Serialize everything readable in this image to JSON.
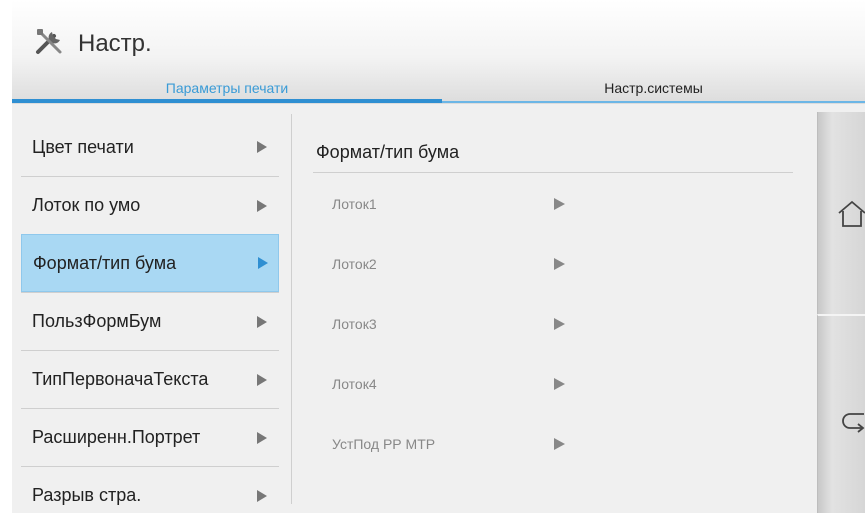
{
  "header": {
    "title": "Настр.",
    "icon": "tools-icon",
    "tabs": [
      {
        "label": "Параметры печати",
        "active": true
      },
      {
        "label": "Настр.системы",
        "active": false
      }
    ],
    "accent": "#2f8fd2"
  },
  "sidebar": {
    "items": [
      {
        "label": "Цвет печати",
        "selected": false
      },
      {
        "label": "Лоток по умо",
        "selected": false
      },
      {
        "label": "Формат/тип бума",
        "selected": true
      },
      {
        "label": "ПользФормБум",
        "selected": false
      },
      {
        "label": "ТипПервоначаТекста",
        "selected": false
      },
      {
        "label": "Расширенн.Портрет",
        "selected": false
      },
      {
        "label": "Разрыв стра.",
        "selected": false
      }
    ]
  },
  "panel": {
    "title": "Формат/тип бума",
    "items": [
      {
        "label": "Лоток1"
      },
      {
        "label": "Лоток2"
      },
      {
        "label": "Лоток3"
      },
      {
        "label": "Лоток4"
      },
      {
        "label": "УстПод РР МТР"
      }
    ]
  },
  "side_buttons": {
    "home_icon": "home-icon",
    "back_icon": "back-icon"
  }
}
